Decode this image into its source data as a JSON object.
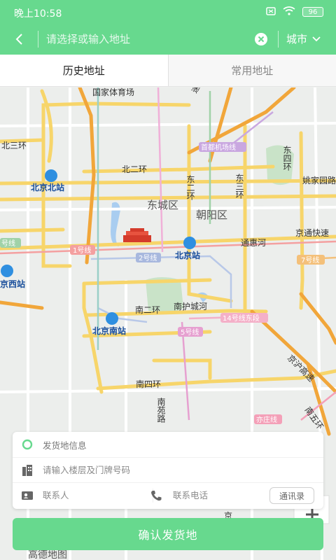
{
  "status_bar": {
    "time": "晚上10:58",
    "battery": "96"
  },
  "header": {
    "search_placeholder": "请选择或输入地址",
    "city_label": "城市"
  },
  "tabs": [
    {
      "label": "历史地址"
    },
    {
      "label": "常用地址"
    }
  ],
  "map": {
    "labels": {
      "stadium": "国家体育场",
      "north3": "北三环",
      "north2": "北二环",
      "east4": "东四环",
      "east3": "东三环",
      "east2": "东二环",
      "yaojia": "姚家园路",
      "dongcheng": "东城区",
      "chaoyang": "朝阳区",
      "jingtong": "京通快速",
      "tonghuihe": "通惠河",
      "beijing_north": "北京北站",
      "beijing_station": "北京站",
      "beijing_west": "京西站",
      "beijing_south": "北京南站",
      "south2": "南二环",
      "nanhu": "南护城河",
      "south4": "南四环",
      "nanyuan": "南苑路",
      "jinghu": "京沪高速",
      "nanwu": "南五环",
      "airport": "首都机场线",
      "line1": "1号线",
      "line2": "2号线",
      "line7": "7号线",
      "line14": "14号线东段",
      "line5": "5号线",
      "yizhuang": "亦庄线",
      "line9": "号线",
      "kuai": "速",
      "jing": "京",
      "logo": "高德地图"
    }
  },
  "form": {
    "origin_label": "发货地信息",
    "floor_placeholder": "请输入楼层及门牌号码",
    "contact_placeholder": "联系人",
    "phone_placeholder": "联系电话",
    "contacts_button": "通讯录"
  },
  "confirm_button": "确认发货地",
  "colors": {
    "accent": "#67d98e"
  }
}
